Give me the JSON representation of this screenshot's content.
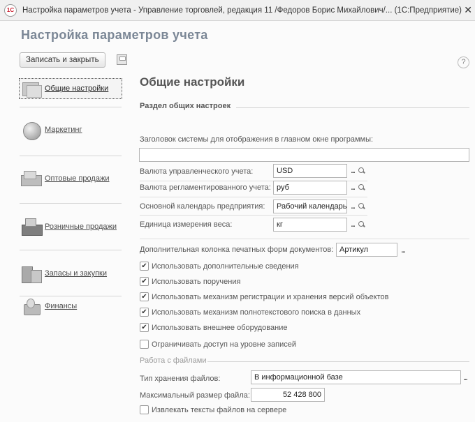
{
  "window": {
    "title": "Настройка параметров учета - Управление торговлей, редакция 11 /Федоров Борис Михайлович/... (1С:Предприятие)",
    "app_badge": "1С",
    "close_glyph": "✕"
  },
  "form": {
    "title": "Настройка параметров учета",
    "save_close_label": "Записать и закрыть",
    "help_glyph": "?"
  },
  "sidebar": {
    "items": [
      {
        "label": "Общие настройки",
        "icon": "general-settings-icon"
      },
      {
        "label": "Маркетинг",
        "icon": "marketing-icon"
      },
      {
        "label": "Оптовые продажи",
        "icon": "wholesale-icon"
      },
      {
        "label": "Розничные продажи",
        "icon": "retail-icon"
      },
      {
        "label": "Запасы и закупки",
        "icon": "stock-icon"
      },
      {
        "label": "Финансы",
        "icon": "finance-icon"
      }
    ]
  },
  "main": {
    "section_title": "Общие настройки",
    "group_title": "Раздел общих настроек",
    "system_title_label": "Заголовок системы для отображения в главном окне программы:",
    "system_title_value": "",
    "fields": [
      {
        "label": "Валюта управленческого учета:",
        "value": "USD"
      },
      {
        "label": "Валюта регламентированного учета:",
        "value": "руб"
      },
      {
        "label": "Основной календарь предприятия:",
        "value": "Рабочий календарь"
      },
      {
        "label": "Единица измерения веса:",
        "value": "кг"
      }
    ],
    "extra_column_label": "Дополнительная колонка печатных форм документов:",
    "extra_column_value": "Артикул",
    "checkboxes": [
      {
        "label": "Использовать дополнительные сведения",
        "checked": true
      },
      {
        "label": "Использовать поручения",
        "checked": true
      },
      {
        "label": "Использовать механизм регистрации и хранения версий объектов",
        "checked": true
      },
      {
        "label": "Использовать механизм полнотекстового поиска в данных",
        "checked": true
      },
      {
        "label": "Использовать внешнее оборудование",
        "checked": true
      },
      {
        "label": "Ограничивать доступ на уровне записей",
        "checked": false
      }
    ],
    "files": {
      "header": "Работа с файлами",
      "storage_label": "Тип хранения файлов:",
      "storage_value": "В информационной базе",
      "max_size_label": "Максимальный размер файла:",
      "max_size_value": "52 428 800",
      "extract_label": "Извлекать тексты файлов на сервере",
      "extract_checked": false
    },
    "check_glyph": "✔",
    "select_dots": "...",
    "search_glyph": "search"
  }
}
